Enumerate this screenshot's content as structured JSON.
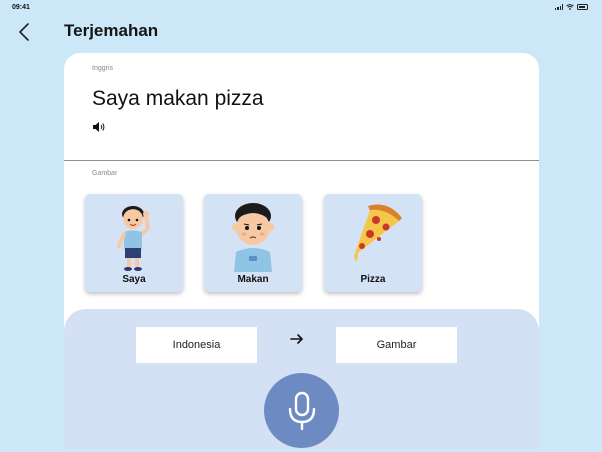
{
  "status_bar": {
    "time": "09:41"
  },
  "header": {
    "title": "Terjemahan"
  },
  "source": {
    "language_label": "Inggris",
    "text": "Saya makan pizza"
  },
  "images_section": {
    "label": "Gambar",
    "tiles": [
      {
        "label": "Saya",
        "icon": "boy-waving-icon"
      },
      {
        "label": "Makan",
        "icon": "boy-eating-icon"
      },
      {
        "label": "Pizza",
        "icon": "pizza-icon"
      }
    ]
  },
  "controls": {
    "from_language": "Indonesia",
    "to_language": "Gambar"
  },
  "colors": {
    "background": "#cbe7f8",
    "card": "#ffffff",
    "tile": "#d4e2f5",
    "panel": "#d4e0f3",
    "mic": "#6e8ac3"
  }
}
